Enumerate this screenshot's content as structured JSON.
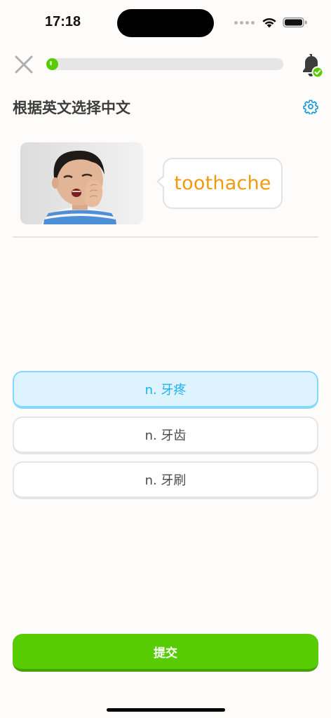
{
  "status_bar": {
    "time": "17:18"
  },
  "top_bar": {
    "progress_fraction": 0.03
  },
  "header": {
    "title": "根据英文选择中文"
  },
  "prompt": {
    "word": "toothache",
    "image_icon": "toothache-photo"
  },
  "options": [
    {
      "label": "n. 牙疼",
      "selected": true
    },
    {
      "label": "n. 牙齿",
      "selected": false
    },
    {
      "label": "n. 牙刷",
      "selected": false
    }
  ],
  "submit_label": "提交",
  "colors": {
    "accent_green": "#58cc02",
    "selected_blue": "#1cb0f6",
    "word_orange": "#f19a0e"
  }
}
